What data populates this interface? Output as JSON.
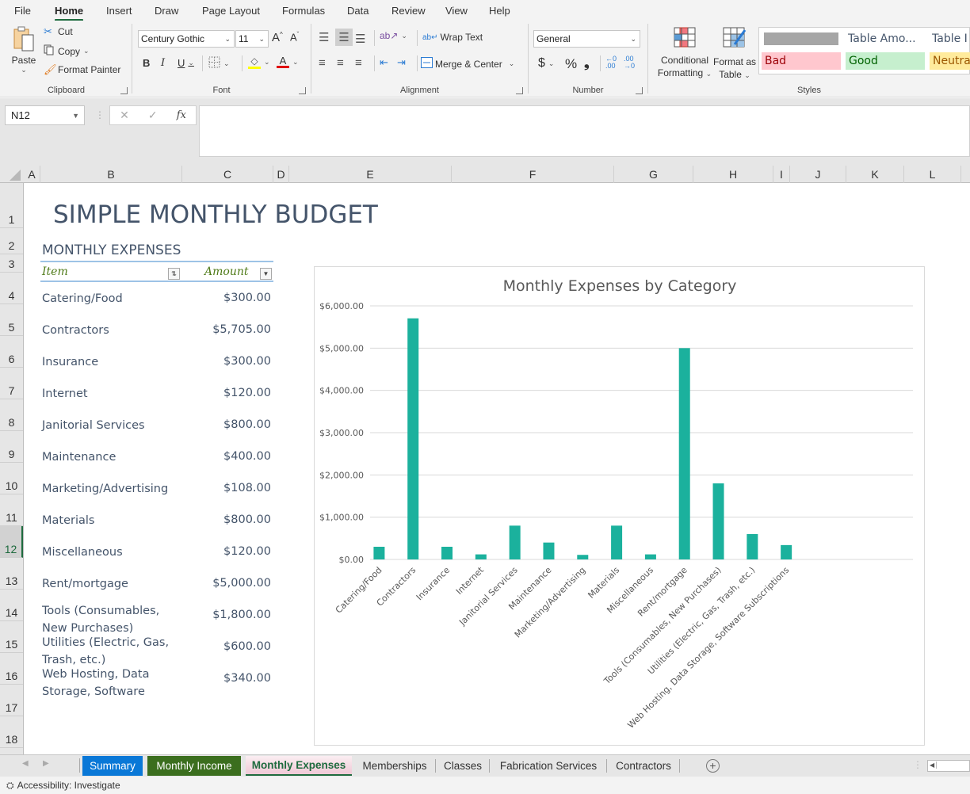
{
  "menu": {
    "tabs": [
      {
        "label": "File"
      },
      {
        "label": "Home"
      },
      {
        "label": "Insert"
      },
      {
        "label": "Draw"
      },
      {
        "label": "Page Layout"
      },
      {
        "label": "Formulas"
      },
      {
        "label": "Data"
      },
      {
        "label": "Review"
      },
      {
        "label": "View"
      },
      {
        "label": "Help"
      }
    ],
    "active": "Home"
  },
  "ribbon": {
    "clipboard": {
      "paste": "Paste",
      "cut": "Cut",
      "copy": "Copy",
      "format_painter": "Format Painter",
      "label": "Clipboard"
    },
    "font": {
      "font_name": "Century Gothic",
      "font_size": "11",
      "bold": "B",
      "italic": "I",
      "underline": "U",
      "label": "Font",
      "highlight_color": "#ffff00",
      "font_color": "#e00000"
    },
    "alignment": {
      "wrap_text": "Wrap Text",
      "merge_center": "Merge & Center",
      "label": "Alignment"
    },
    "number": {
      "format": "General",
      "currency": "$",
      "percent": "%",
      "comma": "9",
      "label": "Number"
    },
    "styles": {
      "conditional_formatting_1": "Conditional",
      "conditional_formatting_2": "Formatting",
      "format_as_table_1": "Format as",
      "format_as_table_2": "Table",
      "gallery": [
        {
          "label": "",
          "bg": "#a6a6a6",
          "color": "#ffffff"
        },
        {
          "label": "Table Amo...",
          "bg": "#ffffff",
          "color": "#44546a"
        },
        {
          "label": "Table I",
          "bg": "#ffffff",
          "color": "#44546a"
        },
        {
          "label": "Bad",
          "bg": "#ffc7ce",
          "color": "#9c0006"
        },
        {
          "label": "Good",
          "bg": "#c6efce",
          "color": "#006100"
        },
        {
          "label": "Neutra",
          "bg": "#ffeb9c",
          "color": "#9c5700"
        }
      ],
      "label": "Styles"
    }
  },
  "formula_bar": {
    "name_box": "N12",
    "cancel": "✕",
    "enter": "✓",
    "fx": "fx",
    "formula": ""
  },
  "columns": [
    "A",
    "B",
    "C",
    "D",
    "E",
    "F",
    "G",
    "H",
    "I",
    "J",
    "K",
    "L"
  ],
  "rows": [
    "1",
    "2",
    "3",
    "4",
    "5",
    "6",
    "7",
    "8",
    "9",
    "10",
    "11",
    "12",
    "13",
    "14",
    "15",
    "16",
    "17",
    "18"
  ],
  "selected_row": "12",
  "sheet": {
    "title": "SIMPLE MONTHLY BUDGET",
    "subtitle": "MONTHLY EXPENSES",
    "table_header": {
      "item": "Item",
      "amount": "Amount"
    },
    "expenses": [
      {
        "item": "Catering/Food",
        "amount": "$300.00"
      },
      {
        "item": "Contractors",
        "amount": "$5,705.00"
      },
      {
        "item": "Insurance",
        "amount": "$300.00"
      },
      {
        "item": "Internet",
        "amount": "$120.00"
      },
      {
        "item": "Janitorial Services",
        "amount": "$800.00"
      },
      {
        "item": "Maintenance",
        "amount": "$400.00"
      },
      {
        "item": "Marketing/Advertising",
        "amount": "$108.00"
      },
      {
        "item": "Materials",
        "amount": "$800.00"
      },
      {
        "item": "Miscellaneous",
        "amount": "$120.00"
      },
      {
        "item": "Rent/mortgage",
        "amount": "$5,000.00"
      },
      {
        "item": "Tools (Consumables, New Purchases)",
        "item_lines": [
          "Tools (Consumables,",
          "New Purchases)"
        ],
        "amount": "$1,800.00"
      },
      {
        "item": "Utilities (Electric, Gas, Trash, etc.)",
        "item_lines": [
          "Utilities (Electric, Gas,",
          "Trash, etc.)"
        ],
        "amount": "$600.00"
      },
      {
        "item": "Web Hosting, Data Storage, Software",
        "item_lines": [
          "Web Hosting, Data",
          "Storage, Software"
        ],
        "amount": "$340.00"
      }
    ]
  },
  "chart_data": {
    "type": "bar",
    "title": "Monthly Expenses by Category",
    "xlabel": "",
    "ylabel": "",
    "categories": [
      "Catering/Food",
      "Contractors",
      "Insurance",
      "Internet",
      "Janitorial Services",
      "Maintenance",
      "Marketing/Advertising",
      "Materials",
      "Miscellaneous",
      "Rent/mortgage",
      "Tools (Consumables, New Purchases)",
      "Utilities (Electric, Gas, Trash, etc.)",
      "Web Hosting, Data Storage, Software Subscriptions"
    ],
    "values": [
      300,
      5705,
      300,
      120,
      800,
      400,
      108,
      800,
      120,
      5000,
      1800,
      600,
      340
    ],
    "ylim": [
      0,
      6000
    ],
    "yticks": [
      0,
      1000,
      2000,
      3000,
      4000,
      5000,
      6000
    ],
    "ytick_labels": [
      "$0.00",
      "$1,000.00",
      "$2,000.00",
      "$3,000.00",
      "$4,000.00",
      "$5,000.00",
      "$6,000.00"
    ],
    "grid": true,
    "legend": "none",
    "bar_color": "#1bb19d",
    "category_slots": 16
  },
  "sheet_tabs": [
    {
      "label": "Summary",
      "bg": "#0a78d7",
      "color": "#ffffff"
    },
    {
      "label": "Monthly Income",
      "bg": "#3b6e1e",
      "color": "#ffffff"
    },
    {
      "label": "Monthly Expenses",
      "bg": "#f3d3dd",
      "color": "#1e6b3e",
      "active": true
    },
    {
      "label": "Memberships",
      "bg": "",
      "color": "#333333"
    },
    {
      "label": "Classes",
      "bg": "",
      "color": "#333333"
    },
    {
      "label": "Fabrication Services",
      "bg": "",
      "color": "#333333"
    },
    {
      "label": "Contractors",
      "bg": "",
      "color": "#333333"
    }
  ],
  "status": {
    "accessibility": "Accessibility: Investigate"
  }
}
